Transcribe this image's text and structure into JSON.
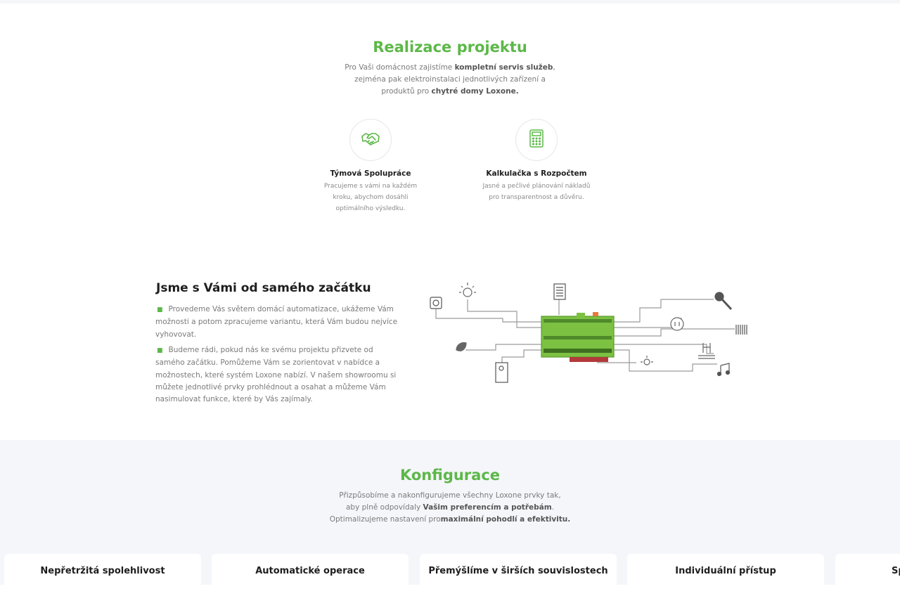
{
  "realizace": {
    "title": "Realizace projektu",
    "desc_line1_a": "Pro Vaši domácnost zajistíme ",
    "desc_line1_b": "kompletní servis služeb",
    "desc_line1_c": ",",
    "desc_line2": "zejména pak elektroinstalaci jednotlivých zařízení a",
    "desc_line3_a": "produktů pro ",
    "desc_line3_b": "chytré domy Loxone."
  },
  "features": [
    {
      "icon": "handshake-icon",
      "title": "Týmová Spolupráce",
      "desc": "Pracujeme s vámi na každém kroku, abychom dosáhli optimálního výsledku."
    },
    {
      "icon": "calculator-icon",
      "title": "Kalkulačka s Rozpočtem",
      "desc": "Jasné a pečlivé plánování nákladů pro transparentnost a důvěru."
    }
  ],
  "jsme": {
    "title": "Jsme s Vámi od samého začátku",
    "bullets": [
      "Provedeme Vás světem domácí automatizace, ukážeme Vám možnosti a potom zpracujeme variantu, která Vám budou nejvíce vyhovovat.",
      "Budeme rádi, pokud nás ke svému projektu přizvete od samého začátku. Pomůžeme Vám se zorientovat v nabídce a možnostech, které systém Loxone nabízí. V našem showroomu si můžete jednotlivé prvky prohlédnout a osahat a můžeme Vám nasimulovat funkce, které by Vás zajímaly."
    ]
  },
  "konfigurace": {
    "title": "Konfigurace",
    "desc_line1": "Přizpůsobíme a nakonfigurujeme všechny Loxone prvky tak,",
    "desc_line2_a": "aby plně odpovídaly ",
    "desc_line2_b": "Vašim preferencím a potřebám",
    "desc_line2_c": ".",
    "desc_line3_a": "Optimalizujeme nastavení pro",
    "desc_line3_b": "maximální pohodlí a efektivitu."
  },
  "cards": [
    {
      "title": "Nepřetržitá spolehlivost"
    },
    {
      "title": "Automatické operace"
    },
    {
      "title": "Přemýšlíme v širších souvislostech"
    },
    {
      "title": "Individuální přístup"
    },
    {
      "title": "Sp"
    }
  ],
  "colors": {
    "accent": "#5cb848",
    "text": "#1e1e1e",
    "muted": "#7a7a7a",
    "section_bg": "#f5f6fa"
  }
}
